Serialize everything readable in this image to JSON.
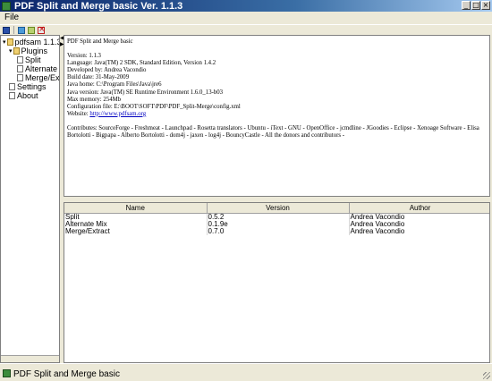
{
  "window": {
    "title": "PDF Split and Merge basic Ver. 1.1.3",
    "minimize_glyph": "_",
    "maximize_glyph": "□",
    "close_glyph": "×"
  },
  "menu": {
    "file_label": "File"
  },
  "toolbar": {
    "icons": [
      "save-icon",
      "add-icon",
      "edit-icon",
      "delete-icon"
    ]
  },
  "tree": {
    "root": "pdfsam 1.1.3",
    "plugins": "Plugins",
    "split": "Split",
    "alternate_mix": "Alternate Mix",
    "merge_extract": "Merge/Extract",
    "settings": "Settings",
    "about": "About"
  },
  "info": {
    "title": "PDF Split and Merge basic",
    "version": "Version: 1.1.3",
    "language": "Language: Java(TM) 2 SDK, Standard Edition, Version 1.4.2",
    "developed_by": "Developed by: Andrea Vacondio",
    "build_date": "Build date: 31-May-2009",
    "java_home": "Java home: C:\\Program Files\\Java\\jre6",
    "java_version": "Java version: Java(TM) SE Runtime Environment 1.6.0_13-b03",
    "max_memory": "Max memory: 254Mb",
    "config_file": "Configuration file: E:\\BOOT\\SOFT\\PDF\\PDF_Split-Merge\\config.xml",
    "website_prefix": "Website: ",
    "website_url": "http://www.pdfsam.org",
    "contributes": "Contributes: SourceForge - Freshmeat - Launchpad - Rosetta translators - Ubuntu - iText - GNU - OpenOffice - jcmdline - JGoodies - Eclipse - Xenoage Software - Elisa Bortolotti - Bigpapa - Alberto Bortolotti - dom4j - jaxen - log4j - BouncyCastle - All the donors and contributors -"
  },
  "plugins_table": {
    "headers": {
      "name": "Name",
      "version": "Version",
      "author": "Author"
    },
    "rows": [
      {
        "name": "Split",
        "version": "0.5.2",
        "author": "Andrea Vacondio"
      },
      {
        "name": "Alternate Mix",
        "version": "0.1.9e",
        "author": "Andrea Vacondio"
      },
      {
        "name": "Merge/Extract",
        "version": "0.7.0",
        "author": "Andrea Vacondio"
      }
    ]
  },
  "status": {
    "text": "PDF Split and Merge basic"
  },
  "colors": {
    "title_bar": "#0a246a",
    "link": "#0000c0",
    "chrome": "#ece9d8"
  }
}
